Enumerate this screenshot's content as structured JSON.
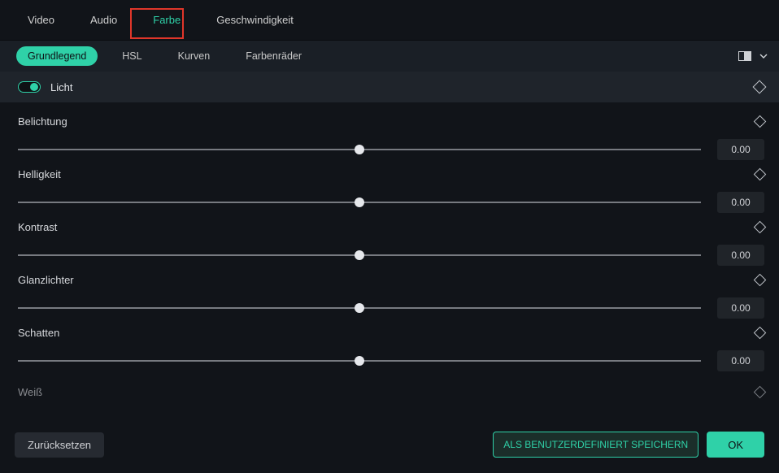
{
  "mainTabs": {
    "video": "Video",
    "audio": "Audio",
    "farbe": "Farbe",
    "geschwindigkeit": "Geschwindigkeit",
    "active": "farbe"
  },
  "subTabs": {
    "grundlegend": "Grundlegend",
    "hsl": "HSL",
    "kurven": "Kurven",
    "farbenraeder": "Farbenräder",
    "active": "grundlegend"
  },
  "section": {
    "title": "Licht"
  },
  "sliders": {
    "belichtung": {
      "label": "Belichtung",
      "value": "0.00"
    },
    "helligkeit": {
      "label": "Helligkeit",
      "value": "0.00"
    },
    "kontrast": {
      "label": "Kontrast",
      "value": "0.00"
    },
    "glanz": {
      "label": "Glanzlichter",
      "value": "0.00"
    },
    "schatten": {
      "label": "Schatten",
      "value": "0.00"
    },
    "weiss": {
      "label": "Weiß"
    }
  },
  "footer": {
    "reset": "Zurücksetzen",
    "saveCustom": "ALS BENUTZERDEFINIERT SPEICHERN",
    "ok": "OK"
  }
}
